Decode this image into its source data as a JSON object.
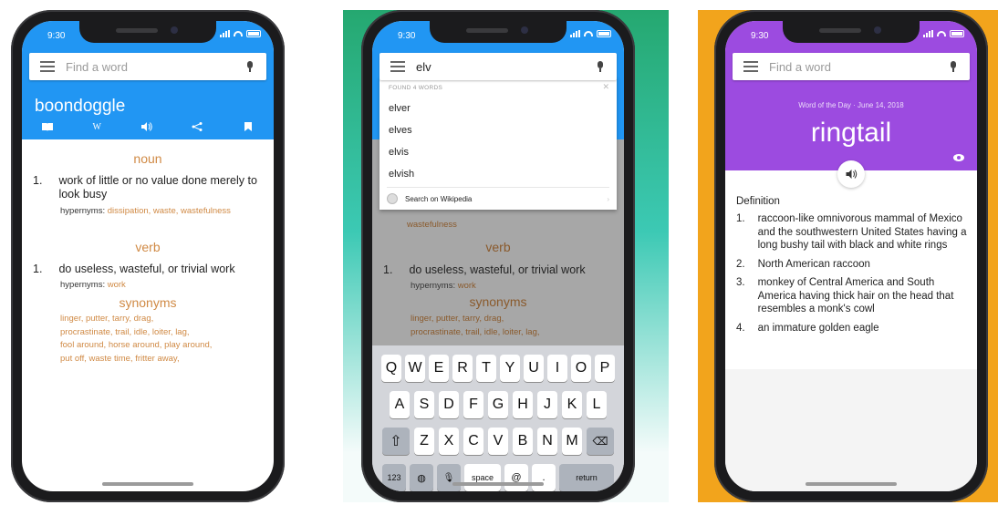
{
  "phone1": {
    "status_time": "9:30",
    "search_placeholder": "Find a word",
    "word": "boondoggle",
    "sections": {
      "noun": "noun",
      "verb": "verb",
      "synonyms": "synonyms"
    },
    "noun_sense": {
      "num": "1.",
      "text": "work of little or no value done merely to look busy",
      "hypernyms_label": "hypernyms:",
      "hypernyms": "dissipation, waste, wastefulness"
    },
    "verb_sense": {
      "num": "1.",
      "text": "do useless, wasteful, or trivial work",
      "hypernyms_label": "hypernyms:",
      "hypernyms": "work"
    },
    "synonyms_lines": [
      "linger, putter, tarry, drag,",
      "procrastinate, trail, idle, loiter, lag,",
      "fool around, horse around, play around,",
      "put off, waste time, fritter away,"
    ],
    "colors": {
      "header": "#2196f3",
      "accent": "#d08a45"
    }
  },
  "phone2": {
    "status_time": "9:30",
    "search_value": "elv",
    "found_label": "FOUND 4 WORDS",
    "suggestions": [
      "elver",
      "elves",
      "elvis",
      "elvish"
    ],
    "wikipedia_label": "Search on Wikipedia",
    "bg_hypernym_tail": "wastefulness",
    "verb_label": "verb",
    "verb_sense": {
      "num": "1.",
      "text": "do useless, wasteful, or trivial work",
      "hypernyms_label": "hypernyms:",
      "hypernyms": "work"
    },
    "synonyms_label": "synonyms",
    "synonyms_lines": [
      "linger, putter, tarry, drag,",
      "procrastinate, trail, idle, loiter, lag,"
    ],
    "keyboard": {
      "row1": [
        "Q",
        "W",
        "E",
        "R",
        "T",
        "Y",
        "U",
        "I",
        "O",
        "P"
      ],
      "row2": [
        "A",
        "S",
        "D",
        "F",
        "G",
        "H",
        "J",
        "K",
        "L"
      ],
      "row3": [
        "Z",
        "X",
        "C",
        "V",
        "B",
        "N",
        "M"
      ],
      "numbers": "123",
      "space": "space",
      "at": "@",
      "period": ".",
      "return": "return"
    }
  },
  "phone3": {
    "status_time": "9:30",
    "search_placeholder": "Find a word",
    "wod_label": "Word of the Day · June 14, 2018",
    "word": "ringtail",
    "definition_label": "Definition",
    "definitions": [
      {
        "num": "1.",
        "text": "raccoon-like omnivorous mammal of Mexico and the southwestern United States having a long bushy tail with black and white rings"
      },
      {
        "num": "2.",
        "text": "North American raccoon"
      },
      {
        "num": "3.",
        "text": "monkey of Central America and South America having thick hair on the head that resembles a monk's cowl"
      },
      {
        "num": "4.",
        "text": "an immature golden eagle"
      }
    ],
    "colors": {
      "header": "#9c4be0"
    }
  },
  "icons": [
    "book-icon",
    "wikipedia-icon",
    "speaker-icon",
    "share-icon",
    "bookmark-icon",
    "menu-icon",
    "microphone-icon",
    "eye-icon",
    "globe-icon",
    "backspace-icon",
    "shift-icon"
  ]
}
